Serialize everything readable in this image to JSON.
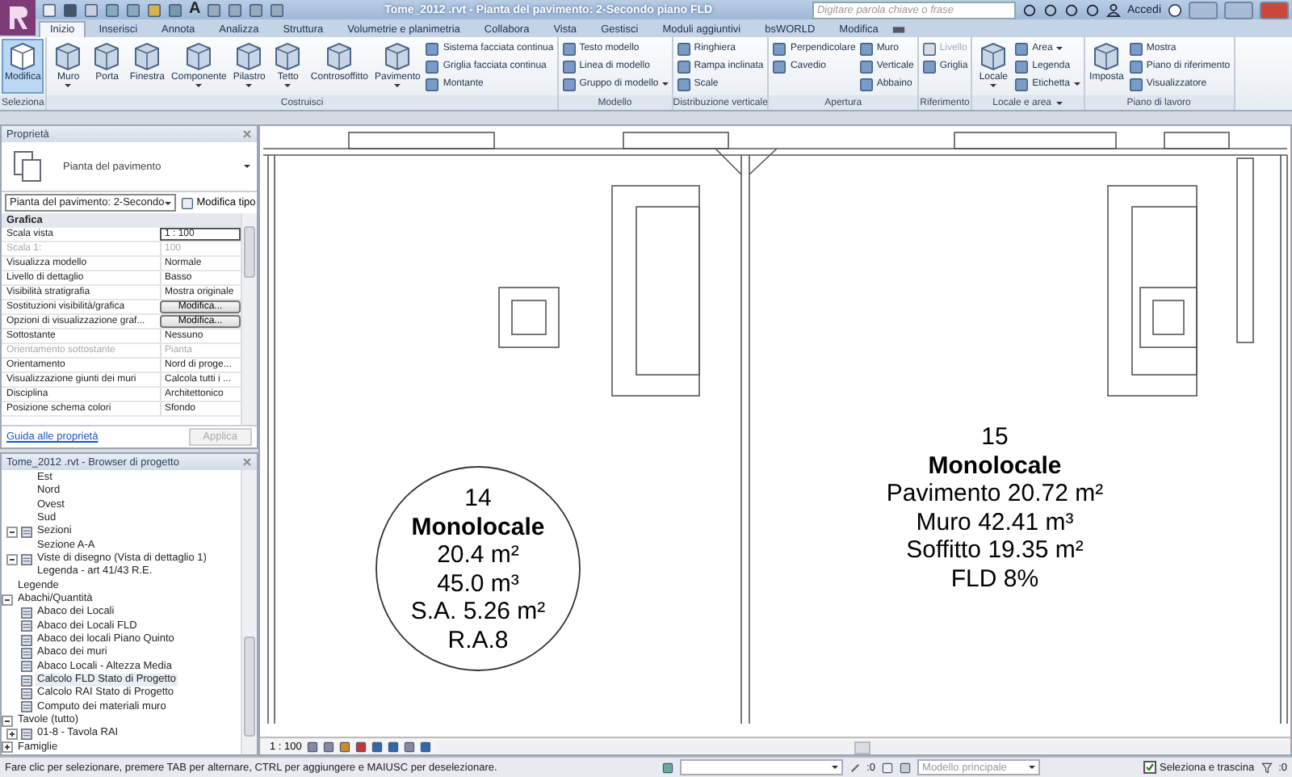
{
  "title_bar": {
    "text_tool_glyph": "A",
    "title": "Tome_2012 .rvt - Pianta del pavimento: 2-Secondo piano FLD",
    "search": {
      "placeholder": "Digitare parola chiave o frase"
    },
    "sign_in": "Accedi"
  },
  "tabs": [
    {
      "label": "Inizio",
      "selected": true
    },
    {
      "label": "Inserisci",
      "selected": false
    },
    {
      "label": "Annota",
      "selected": false
    },
    {
      "label": "Analizza",
      "selected": false
    },
    {
      "label": "Struttura",
      "selected": false
    },
    {
      "label": "Volumetrie e planimetria",
      "selected": false
    },
    {
      "label": "Collabora",
      "selected": false
    },
    {
      "label": "Vista",
      "selected": false
    },
    {
      "label": "Gestisci",
      "selected": false
    },
    {
      "label": "Moduli aggiuntivi",
      "selected": false
    },
    {
      "label": "bsWORLD",
      "selected": false
    },
    {
      "label": "Modifica",
      "selected": false
    }
  ],
  "ribbon_panels": [
    {
      "title": "Seleziona",
      "dropdown": false,
      "groups": [
        {
          "kind": "large",
          "label": "Modifica",
          "active": true,
          "dropdown": false
        }
      ]
    },
    {
      "title": "Costruisci",
      "dropdown": false,
      "groups": [
        {
          "kind": "large",
          "label": "Muro",
          "active": false,
          "dropdown": true
        },
        {
          "kind": "large",
          "label": "Porta",
          "active": false,
          "dropdown": false
        },
        {
          "kind": "large",
          "label": "Finestra",
          "active": false,
          "dropdown": false
        },
        {
          "kind": "large",
          "label": "Componente",
          "active": false,
          "dropdown": true
        },
        {
          "kind": "large",
          "label": "Pilastro",
          "active": false,
          "dropdown": true
        },
        {
          "kind": "large",
          "label": "Tetto",
          "active": false,
          "dropdown": true
        },
        {
          "kind": "large",
          "label": "Controsoffitto",
          "active": false,
          "dropdown": false
        },
        {
          "kind": "large",
          "label": "Pavimento",
          "active": false,
          "dropdown": true
        },
        {
          "kind": "stack",
          "items": [
            {
              "label": "Sistema facciata continua",
              "disabled": false,
              "dropdown": false
            },
            {
              "label": "Griglia facciata continua",
              "disabled": false,
              "dropdown": false
            },
            {
              "label": "Montante",
              "disabled": false,
              "dropdown": false
            }
          ]
        }
      ]
    },
    {
      "title": "Modello",
      "dropdown": false,
      "groups": [
        {
          "kind": "stack",
          "items": [
            {
              "label": "Testo modello",
              "disabled": false,
              "dropdown": false
            },
            {
              "label": "Linea di modello",
              "disabled": false,
              "dropdown": false
            },
            {
              "label": "Gruppo di modello",
              "disabled": false,
              "dropdown": true
            }
          ]
        }
      ]
    },
    {
      "title": "Distribuzione verticale",
      "dropdown": false,
      "groups": [
        {
          "kind": "stack",
          "items": [
            {
              "label": "Ringhiera",
              "disabled": false,
              "dropdown": false
            },
            {
              "label": "Rampa inclinata",
              "disabled": false,
              "dropdown": false
            },
            {
              "label": "Scale",
              "disabled": false,
              "dropdown": false
            }
          ]
        }
      ]
    },
    {
      "title": "Apertura",
      "dropdown": false,
      "groups": [
        {
          "kind": "stack",
          "items": [
            {
              "label": "Perpendicolare",
              "disabled": false,
              "dropdown": false
            },
            {
              "label": "Cavedio",
              "disabled": false,
              "dropdown": false
            }
          ]
        },
        {
          "kind": "stack",
          "items": [
            {
              "label": "Muro",
              "disabled": false,
              "dropdown": false
            },
            {
              "label": "Verticale",
              "disabled": false,
              "dropdown": false
            },
            {
              "label": "Abbaino",
              "disabled": false,
              "dropdown": false
            }
          ]
        }
      ]
    },
    {
      "title": "Riferimento",
      "dropdown": false,
      "groups": [
        {
          "kind": "stack",
          "items": [
            {
              "label": "Livello",
              "disabled": true,
              "dropdown": false
            },
            {
              "label": "Griglia",
              "disabled": false,
              "dropdown": false
            }
          ]
        }
      ]
    },
    {
      "title": "Locale e area",
      "dropdown": true,
      "groups": [
        {
          "kind": "large",
          "label": "Locale",
          "active": false,
          "dropdown": true
        },
        {
          "kind": "stack",
          "items": [
            {
              "label": "Area",
              "disabled": false,
              "dropdown": true
            },
            {
              "label": "Legenda",
              "disabled": false,
              "dropdown": false
            },
            {
              "label": "Etichetta",
              "disabled": false,
              "dropdown": true
            }
          ]
        }
      ]
    },
    {
      "title": "Piano di lavoro",
      "dropdown": false,
      "groups": [
        {
          "kind": "large",
          "label": "Imposta",
          "active": false,
          "dropdown": false
        },
        {
          "kind": "stack",
          "items": [
            {
              "label": "Mostra",
              "disabled": false,
              "dropdown": false
            },
            {
              "label": "Piano di riferimento",
              "disabled": false,
              "dropdown": false
            },
            {
              "label": "Visualizzatore",
              "disabled": false,
              "dropdown": false
            }
          ]
        }
      ]
    }
  ],
  "properties": {
    "title": "Proprietà",
    "type_name": "Pianta del pavimento",
    "selector": "Pianta del pavimento: 2-Secondo",
    "edit_type": "Modifica tipo",
    "group": "Grafica",
    "rows": [
      {
        "name": "Scala vista",
        "value": "1 : 100",
        "kind": "field",
        "disabled": false
      },
      {
        "name": "Scala 1:",
        "value": "100",
        "kind": "text",
        "disabled": true
      },
      {
        "name": "Visualizza modello",
        "value": "Normale",
        "kind": "text",
        "disabled": false
      },
      {
        "name": "Livello di dettaglio",
        "value": "Basso",
        "kind": "text",
        "disabled": false
      },
      {
        "name": "Visibilità stratigrafia",
        "value": "Mostra originale",
        "kind": "text",
        "disabled": false
      },
      {
        "name": "Sostituzioni visibilità/grafica",
        "value": "Modifica...",
        "kind": "button",
        "disabled": false
      },
      {
        "name": "Opzioni di visualizzazione graf...",
        "value": "Modifica...",
        "kind": "button",
        "disabled": false
      },
      {
        "name": "Sottostante",
        "value": "Nessuno",
        "kind": "text",
        "disabled": false
      },
      {
        "name": "Orientamento sottostante",
        "value": "Pianta",
        "kind": "text",
        "disabled": true
      },
      {
        "name": "Orientamento",
        "value": "Nord di proge...",
        "kind": "text",
        "disabled": false
      },
      {
        "name": "Visualizzazione giunti dei muri",
        "value": "Calcola tutti i ...",
        "kind": "text",
        "disabled": false
      },
      {
        "name": "Disciplina",
        "value": "Architettonico",
        "kind": "text",
        "disabled": false
      },
      {
        "name": "Posizione schema colori",
        "value": "Sfondo",
        "kind": "text",
        "disabled": false
      }
    ],
    "help_link": "Guida alle proprietà",
    "apply": "Applica"
  },
  "browser": {
    "title": "Tome_2012 .rvt - Browser di progetto",
    "tree": [
      {
        "children": [
          {
            "children": [
              {
                "label": "Est",
                "selected": false
              },
              {
                "label": "Nord",
                "selected": false
              },
              {
                "label": "Ovest",
                "selected": false
              },
              {
                "label": "Sud",
                "selected": false
              }
            ]
          },
          {
            "label": "Sezioni",
            "selected": false,
            "expanded": true,
            "children": [
              {
                "label": "Sezione A-A",
                "selected": false
              }
            ]
          },
          {
            "label": "Viste di disegno (Vista di dettaglio 1)",
            "selected": false,
            "expanded": true,
            "children": [
              {
                "label": "Legenda - art 41/43 R.E.",
                "selected": false
              }
            ]
          }
        ]
      },
      {
        "label": "Legende",
        "selected": false
      },
      {
        "label": "Abachi/Quantità",
        "selected": false,
        "expanded": true,
        "children": [
          {
            "label": "Abaco dei Locali",
            "selected": false
          },
          {
            "label": "Abaco dei Locali FLD",
            "selected": false
          },
          {
            "label": "Abaco dei locali Piano Quinto",
            "selected": false
          },
          {
            "label": "Abaco dei muri",
            "selected": false
          },
          {
            "label": "Abaco Locali - Altezza Media",
            "selected": false
          },
          {
            "label": "Calcolo FLD Stato di Progetto",
            "selected": true
          },
          {
            "label": "Calcolo RAI Stato di Progetto",
            "selected": false
          },
          {
            "label": "Computo dei materiali muro",
            "selected": false
          }
        ]
      },
      {
        "label": "Tavole (tutto)",
        "selected": false,
        "expanded": true,
        "children": [
          {
            "label": "01-8 - Tavola RAI",
            "selected": false,
            "expanded": false
          }
        ]
      },
      {
        "label": "Famiglie",
        "selected": false,
        "expanded": false
      }
    ]
  },
  "rooms": [
    {
      "kind": "circle",
      "number": "14",
      "name": "Monolocale",
      "lines": [
        "20.4 m²",
        "45.0 m³",
        "S.A. 5.26 m²",
        "R.A.8"
      ]
    },
    {
      "kind": "plain",
      "number": "15",
      "name": "Monolocale",
      "lines": [
        "Pavimento 20.72 m²",
        "Muro 42.41 m³",
        "Soffitto 19.35 m²",
        "FLD 8%"
      ]
    }
  ],
  "view_bar": {
    "scale": "1 : 100"
  },
  "status_bar": {
    "message": "Fare clic per selezionare, premere TAB per alternare, CTRL per aggiungere e MAIUSC per deselezionare.",
    "selection_count": ":0",
    "model": "Modello principale",
    "drag_select": {
      "label": "Seleziona e trascina",
      "checked": true
    },
    "filter_count": ":0"
  }
}
